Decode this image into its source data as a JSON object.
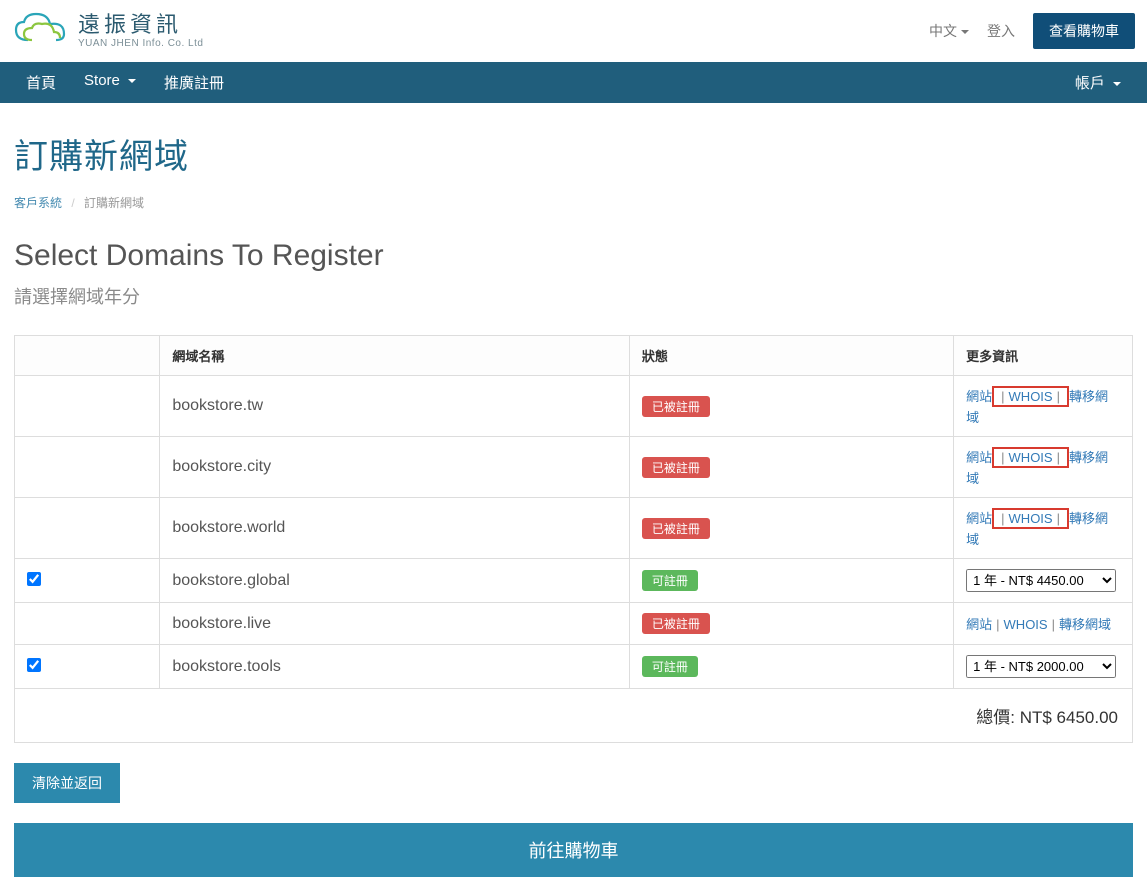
{
  "brand": {
    "cn": "遠振資訊",
    "en": "YUAN JHEN Info. Co. Ltd"
  },
  "top": {
    "lang": "中文",
    "login": "登入",
    "cart": "查看購物車"
  },
  "nav": {
    "home": "首頁",
    "store": "Store",
    "referral": "推廣註冊",
    "account": "帳戶"
  },
  "page": {
    "title": "訂購新網域",
    "crumb_home": "客戶系統",
    "crumb_current": "訂購新網域",
    "section_title": "Select Domains To Register",
    "section_sub": "請選擇網域年分"
  },
  "table": {
    "headers": {
      "domain": "網域名稱",
      "status": "狀態",
      "more": "更多資訊"
    },
    "status_taken": "已被註冊",
    "status_avail": "可註冊",
    "link_site": "網站",
    "link_whois": "WHOIS",
    "link_transfer": "轉移網域",
    "rows": [
      {
        "domain": "bookstore.tw",
        "status": "taken",
        "checked": false,
        "highlight_whois": true
      },
      {
        "domain": "bookstore.city",
        "status": "taken",
        "checked": false,
        "highlight_whois": true
      },
      {
        "domain": "bookstore.world",
        "status": "taken",
        "checked": false,
        "highlight_whois": true
      },
      {
        "domain": "bookstore.global",
        "status": "avail",
        "checked": true,
        "year_option": "1 年 - NT$ 4450.00"
      },
      {
        "domain": "bookstore.live",
        "status": "taken",
        "checked": false,
        "highlight_whois": false
      },
      {
        "domain": "bookstore.tools",
        "status": "avail",
        "checked": true,
        "year_option": "1 年 - NT$ 2000.00"
      }
    ],
    "total_label": "總價:",
    "total_value": "NT$ 6450.00"
  },
  "buttons": {
    "clear": "清除並返回",
    "go_cart": "前往購物車"
  }
}
